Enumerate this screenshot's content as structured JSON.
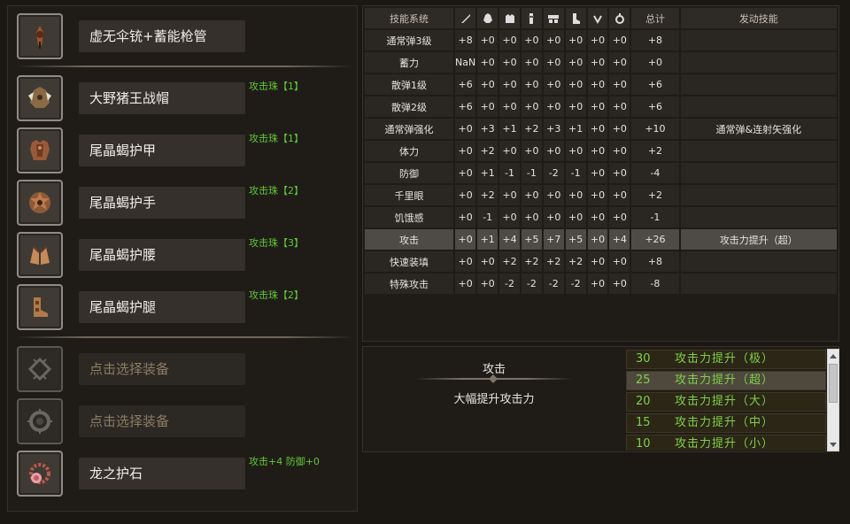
{
  "equipment": [
    {
      "name": "虚无伞铳+蓄能枪管",
      "gem": "",
      "icon": "gunlance-icon",
      "empty": false
    },
    {
      "name": "大野猪王战帽",
      "gem": "攻击珠【1】",
      "icon": "helmet-icon",
      "empty": false
    },
    {
      "name": "尾晶蝎护甲",
      "gem": "攻击珠【1】",
      "icon": "chest-armor-icon",
      "empty": false
    },
    {
      "name": "尾晶蝎护手",
      "gem": "攻击珠【2】",
      "icon": "gauntlet-icon",
      "empty": false
    },
    {
      "name": "尾晶蝎护腰",
      "gem": "攻击珠【3】",
      "icon": "waist-armor-icon",
      "empty": false
    },
    {
      "name": "尾晶蝎护腿",
      "gem": "攻击珠【2】",
      "icon": "leg-armor-icon",
      "empty": false
    },
    {
      "name": "点击选择装备",
      "gem": "",
      "icon": "empty-slot-icon",
      "empty": true
    },
    {
      "name": "点击选择装备",
      "gem": "",
      "icon": "empty-ring-slot-icon",
      "empty": true
    },
    {
      "name": "龙之护石",
      "gem": "攻击+4 防御+0",
      "icon": "talisman-icon",
      "empty": false
    }
  ],
  "table": {
    "header": {
      "skill": "技能系统",
      "total": "总计",
      "activated": "发动技能",
      "columns": [
        "weapon-icon",
        "helmet-icon",
        "chest-icon",
        "arm-icon",
        "waist-icon",
        "leg-icon",
        "talisman-icon",
        "charm-icon"
      ]
    },
    "rows": [
      {
        "name": "通常弹3级",
        "values": [
          "+8",
          "+0",
          "+0",
          "+0",
          "+0",
          "+0",
          "+0",
          "+0"
        ],
        "total": "+8",
        "activated": "",
        "selected": false
      },
      {
        "name": "蓄力",
        "values": [
          "NaN",
          "+0",
          "+0",
          "+0",
          "+0",
          "+0",
          "+0",
          "+0"
        ],
        "total": "+0",
        "activated": "",
        "selected": false
      },
      {
        "name": "散弹1级",
        "values": [
          "+6",
          "+0",
          "+0",
          "+0",
          "+0",
          "+0",
          "+0",
          "+0"
        ],
        "total": "+6",
        "activated": "",
        "selected": false
      },
      {
        "name": "散弹2级",
        "values": [
          "+6",
          "+0",
          "+0",
          "+0",
          "+0",
          "+0",
          "+0",
          "+0"
        ],
        "total": "+6",
        "activated": "",
        "selected": false
      },
      {
        "name": "通常弹强化",
        "values": [
          "+0",
          "+3",
          "+1",
          "+2",
          "+3",
          "+1",
          "+0",
          "+0"
        ],
        "total": "+10",
        "activated": "通常弹&连射矢强化",
        "selected": false
      },
      {
        "name": "体力",
        "values": [
          "+0",
          "+2",
          "+0",
          "+0",
          "+0",
          "+0",
          "+0",
          "+0"
        ],
        "total": "+2",
        "activated": "",
        "selected": false
      },
      {
        "name": "防御",
        "values": [
          "+0",
          "+1",
          "-1",
          "-1",
          "-2",
          "-1",
          "+0",
          "+0"
        ],
        "total": "-4",
        "activated": "",
        "selected": false
      },
      {
        "name": "千里眼",
        "values": [
          "+0",
          "+2",
          "+0",
          "+0",
          "+0",
          "+0",
          "+0",
          "+0"
        ],
        "total": "+2",
        "activated": "",
        "selected": false
      },
      {
        "name": "饥饿感",
        "values": [
          "+0",
          "-1",
          "+0",
          "+0",
          "+0",
          "+0",
          "+0",
          "+0"
        ],
        "total": "-1",
        "activated": "",
        "selected": false
      },
      {
        "name": "攻击",
        "values": [
          "+0",
          "+1",
          "+4",
          "+5",
          "+7",
          "+5",
          "+0",
          "+4"
        ],
        "total": "+26",
        "activated": "攻击力提升（超）",
        "selected": true
      },
      {
        "name": "快速装填",
        "values": [
          "+0",
          "+0",
          "+2",
          "+2",
          "+2",
          "+2",
          "+0",
          "+0"
        ],
        "total": "+8",
        "activated": "",
        "selected": false
      },
      {
        "name": "特殊攻击",
        "values": [
          "+0",
          "+0",
          "-2",
          "-2",
          "-2",
          "-2",
          "+0",
          "+0"
        ],
        "total": "-8",
        "activated": "",
        "selected": false
      }
    ]
  },
  "description": {
    "title": "攻击",
    "text": "大幅提升攻击力"
  },
  "levels": [
    {
      "points": "30",
      "name": "攻击力提升（极）",
      "selected": false
    },
    {
      "points": "25",
      "name": "攻击力提升（超）",
      "selected": true
    },
    {
      "points": "20",
      "name": "攻击力提升（大）",
      "selected": false
    },
    {
      "points": "15",
      "name": "攻击力提升（中）",
      "selected": false
    },
    {
      "points": "10",
      "name": "攻击力提升（小）",
      "selected": false
    }
  ],
  "colors": {
    "accent_green": "#63c838",
    "selected_row": "#4e4a46"
  }
}
